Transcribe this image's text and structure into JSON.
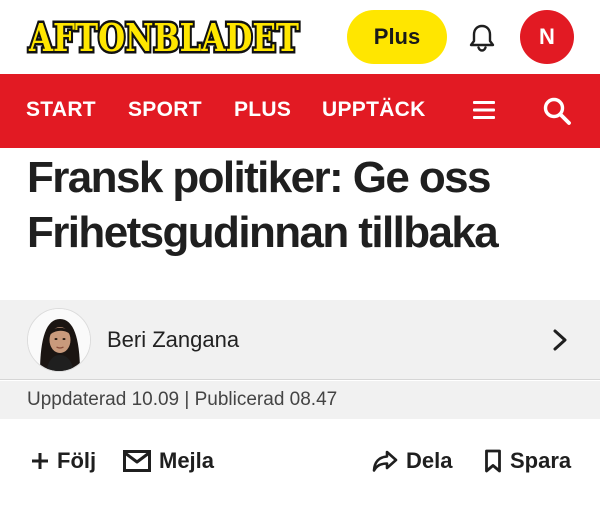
{
  "header": {
    "logo_text": "AFTONBLADET",
    "plus_label": "Plus",
    "avatar_initial": "N",
    "colors": {
      "brand_red": "#e21a23",
      "plus_yellow": "#ffe600"
    }
  },
  "nav": {
    "items": [
      {
        "label": "START"
      },
      {
        "label": "SPORT"
      },
      {
        "label": "PLUS"
      },
      {
        "label": "UPPTÄCK"
      }
    ],
    "icons": [
      "menu-icon",
      "search-icon"
    ]
  },
  "article": {
    "headline": "Fransk politiker: Ge oss Frihetsgudinnan tillbaka",
    "author": {
      "name": "Beri Zangana"
    },
    "meta": "Uppdaterad 10.09 | Publicerad 08.47"
  },
  "actions": {
    "follow": "Följ",
    "mail": "Mejla",
    "share": "Dela",
    "save": "Spara"
  }
}
